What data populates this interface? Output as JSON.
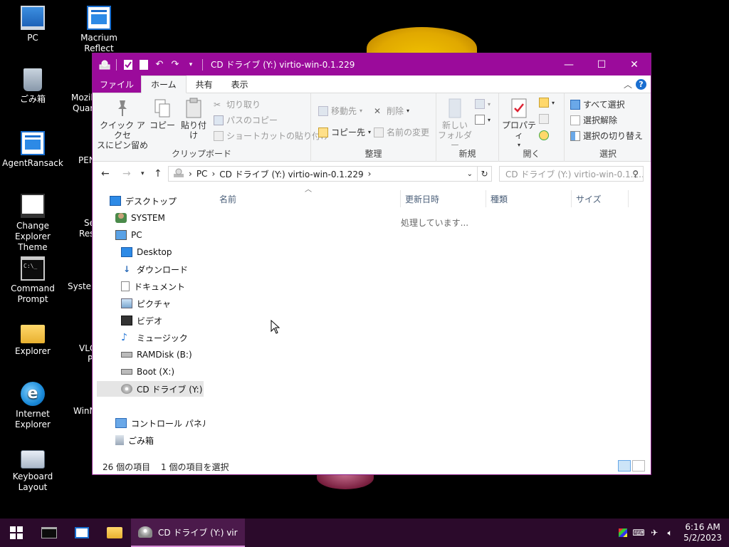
{
  "desktop": {
    "icons": [
      {
        "label": "PC"
      },
      {
        "label": "Macrium Reflect"
      },
      {
        "label": "ごみ箱"
      },
      {
        "label": "AgentRansack"
      },
      {
        "label": "Change Explorer Theme"
      },
      {
        "label": "Command Prompt"
      },
      {
        "label": "Explorer"
      },
      {
        "label": "Internet Explorer"
      },
      {
        "label": "Keyboard Layout"
      }
    ],
    "partial_labels": [
      "Mozil",
      "Quan",
      "PEN",
      "Se",
      "Res",
      "System",
      "VLC",
      "P",
      "WinN"
    ]
  },
  "window": {
    "title": "CD ドライブ (Y:) virtio-win-0.1.229",
    "tabs": {
      "file": "ファイル",
      "home": "ホーム",
      "share": "共有",
      "view": "表示"
    },
    "ribbon": {
      "clipboard": {
        "label": "クリップボード",
        "pin_line1": "クイック アクセ",
        "pin_line2": "スにピン留め",
        "copy": "コピー",
        "paste": "貼り付け",
        "cut": "切り取り",
        "copy_path": "パスのコピー",
        "paste_shortcut": "ショートカットの貼り付け"
      },
      "organize": {
        "label": "整理",
        "move_to": "移動先",
        "copy_to": "コピー先",
        "delete": "削除",
        "rename": "名前の変更"
      },
      "new": {
        "label": "新規",
        "new_folder_line1": "新しい",
        "new_folder_line2": "フォルダー"
      },
      "open": {
        "label": "開く",
        "properties": "プロパティ"
      },
      "select": {
        "label": "選択",
        "select_all": "すべて選択",
        "select_none": "選択解除",
        "invert": "選択の切り替え"
      }
    },
    "address": {
      "segments": [
        "PC",
        "CD ドライブ (Y:) virtio-win-0.1.229"
      ],
      "search_placeholder": "CD ドライブ (Y:) virtio-win-0.1.2..."
    },
    "nav": [
      {
        "label": "デスクトップ"
      },
      {
        "label": "SYSTEM"
      },
      {
        "label": "PC"
      },
      {
        "label": "Desktop"
      },
      {
        "label": "ダウンロード"
      },
      {
        "label": "ドキュメント"
      },
      {
        "label": "ピクチャ"
      },
      {
        "label": "ビデオ"
      },
      {
        "label": "ミュージック"
      },
      {
        "label": "RAMDisk (B:)"
      },
      {
        "label": "Boot (X:)"
      },
      {
        "label": "CD ドライブ (Y:) virti"
      },
      {
        "label": "コントロール パネル"
      },
      {
        "label": "ごみ箱"
      }
    ],
    "columns": {
      "name": "名前",
      "date": "更新日時",
      "type": "種類",
      "size": "サイズ"
    },
    "processing": "処理しています...",
    "status": {
      "count": "26 個の項目",
      "selected": "1 個の項目を選択"
    }
  },
  "taskbar": {
    "active_label": "CD ドライブ (Y:) virtio-...",
    "time": "6:16 AM",
    "date": "5/2/2023"
  },
  "colors": {
    "accent": "#9b0b9b",
    "taskbar": "#2b0a2b"
  }
}
